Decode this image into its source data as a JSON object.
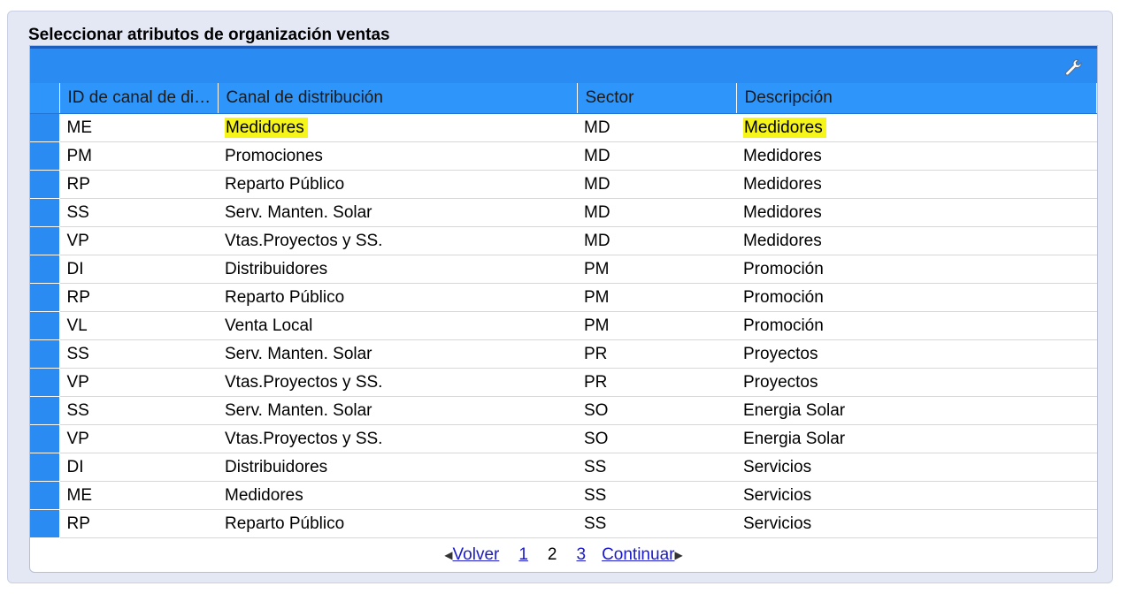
{
  "panel": {
    "title": "Seleccionar atributos de organización ventas"
  },
  "table": {
    "columns": [
      "ID de canal de di…",
      "Canal de distribución",
      "Sector",
      "Descripción"
    ],
    "rows": [
      {
        "id": "ME",
        "canal": "Medidores",
        "sector": "MD",
        "desc": "Medidores",
        "highlight": true
      },
      {
        "id": "PM",
        "canal": "Promociones",
        "sector": "MD",
        "desc": "Medidores"
      },
      {
        "id": "RP",
        "canal": "Reparto Público",
        "sector": "MD",
        "desc": "Medidores"
      },
      {
        "id": "SS",
        "canal": "Serv. Manten. Solar",
        "sector": "MD",
        "desc": "Medidores"
      },
      {
        "id": "VP",
        "canal": "Vtas.Proyectos y SS.",
        "sector": "MD",
        "desc": "Medidores"
      },
      {
        "id": "DI",
        "canal": "Distribuidores",
        "sector": "PM",
        "desc": "Promoción"
      },
      {
        "id": "RP",
        "canal": "Reparto Público",
        "sector": "PM",
        "desc": "Promoción"
      },
      {
        "id": "VL",
        "canal": "Venta Local",
        "sector": "PM",
        "desc": "Promoción"
      },
      {
        "id": "SS",
        "canal": "Serv. Manten. Solar",
        "sector": "PR",
        "desc": "Proyectos"
      },
      {
        "id": "VP",
        "canal": "Vtas.Proyectos y SS.",
        "sector": "PR",
        "desc": "Proyectos"
      },
      {
        "id": "SS",
        "canal": "Serv. Manten. Solar",
        "sector": "SO",
        "desc": "Energia Solar"
      },
      {
        "id": "VP",
        "canal": "Vtas.Proyectos y SS.",
        "sector": "SO",
        "desc": "Energia Solar"
      },
      {
        "id": "DI",
        "canal": "Distribuidores",
        "sector": "SS",
        "desc": "Servicios"
      },
      {
        "id": "ME",
        "canal": "Medidores",
        "sector": "SS",
        "desc": "Servicios"
      },
      {
        "id": "RP",
        "canal": "Reparto Público",
        "sector": "SS",
        "desc": "Servicios"
      }
    ]
  },
  "pager": {
    "prev_label": "Volver",
    "pages": [
      "1",
      "2",
      "3"
    ],
    "current_page": "2",
    "next_label": "Continuar"
  },
  "icons": {
    "toolbar_settings": "wrench-icon"
  },
  "colors": {
    "header_blue": "#2e96fb",
    "highlight": "#f5f51a"
  }
}
